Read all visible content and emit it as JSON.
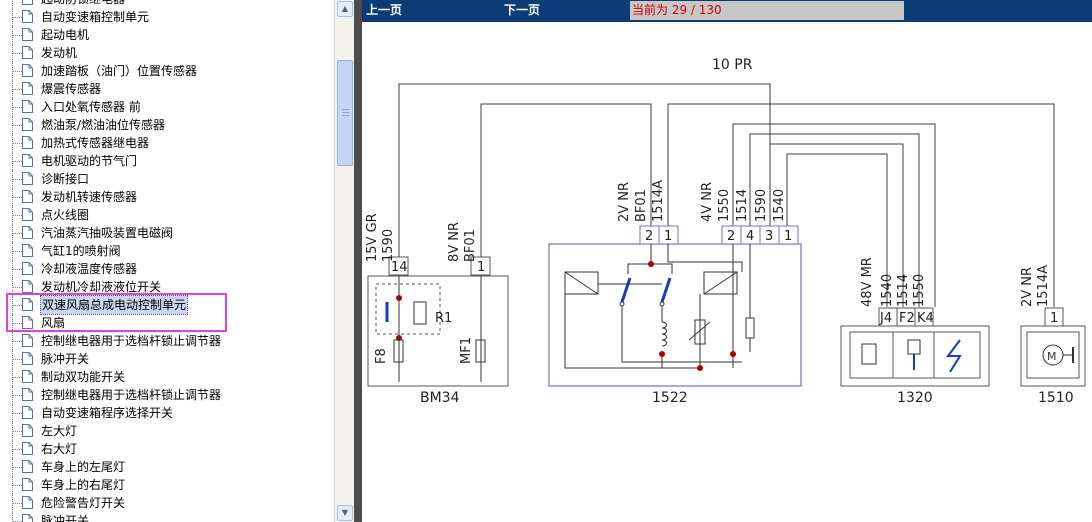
{
  "tree_items": [
    "起动防锁继电器",
    "自动变速箱控制单元",
    "起动电机",
    "发动机",
    "加速踏板（油门）位置传感器",
    "爆震传感器",
    "入口处氧传感器 前",
    "燃油泵/燃油油位传感器",
    "加热式传感器继电器",
    "电机驱动的节气门",
    "诊断接口",
    "发动机转速传感器",
    "点火线圈",
    "汽油蒸汽抽吸装置电磁阀",
    "气缸1的喷射阀",
    "冷却液温度传感器",
    "发动机冷却液液位开关",
    "双速风扇总成电动控制单元",
    "风扇",
    "控制继电器用于选档杆锁止调节器",
    "脉冲开关",
    "制动双功能开关",
    "控制继电器用于选档杆锁止调节器",
    "自动变速箱程序选择开关",
    "左大灯",
    "右大灯",
    "车身上的左尾灯",
    "车身上的右尾灯",
    "危险警告灯开关",
    "脉冲开关"
  ],
  "selected_index": 17,
  "nav": {
    "prev_label": "上一页",
    "next_label": "下一页",
    "page_indicator": "当前为  29 / 130"
  },
  "diagram": {
    "connector_top": "10  PR",
    "c1_wire": "15V GR",
    "c1_num": "1590",
    "c1_pin": "14",
    "c2_wire": "8V NR",
    "c2_num": "BF01",
    "c2_pin": "1",
    "c3_wire": "2V NR",
    "c3_num1": "BF01",
    "c3_num2": "1514A",
    "c3_pins": [
      "2",
      "1"
    ],
    "c4_wire": "4V NR",
    "c4_nums": [
      "1550",
      "1514",
      "1590",
      "1540"
    ],
    "c4_pins": [
      "2",
      "4",
      "3",
      "1"
    ],
    "c5_wire": "48V MR",
    "c5_nums": [
      "1540",
      "1514",
      "1550"
    ],
    "c5_pins": [
      "J4",
      "F2",
      "K4"
    ],
    "c6_wire": "2V NR",
    "c6_num": "1514A",
    "c6_pin": "1",
    "bm34_r1": "R1",
    "bm34_f8": "F8",
    "bm34_mf1": "MF1",
    "comp_labels": [
      "BM34",
      "1522",
      "1320",
      "1510"
    ]
  },
  "colors": {
    "nav_bar": "#0b3c76",
    "page_text": "#d10000",
    "highlight_box": "#e040e0",
    "wire": "#3c3c3c",
    "connector_outline": "#7a6ad6",
    "relay_junction": "#b00000"
  }
}
